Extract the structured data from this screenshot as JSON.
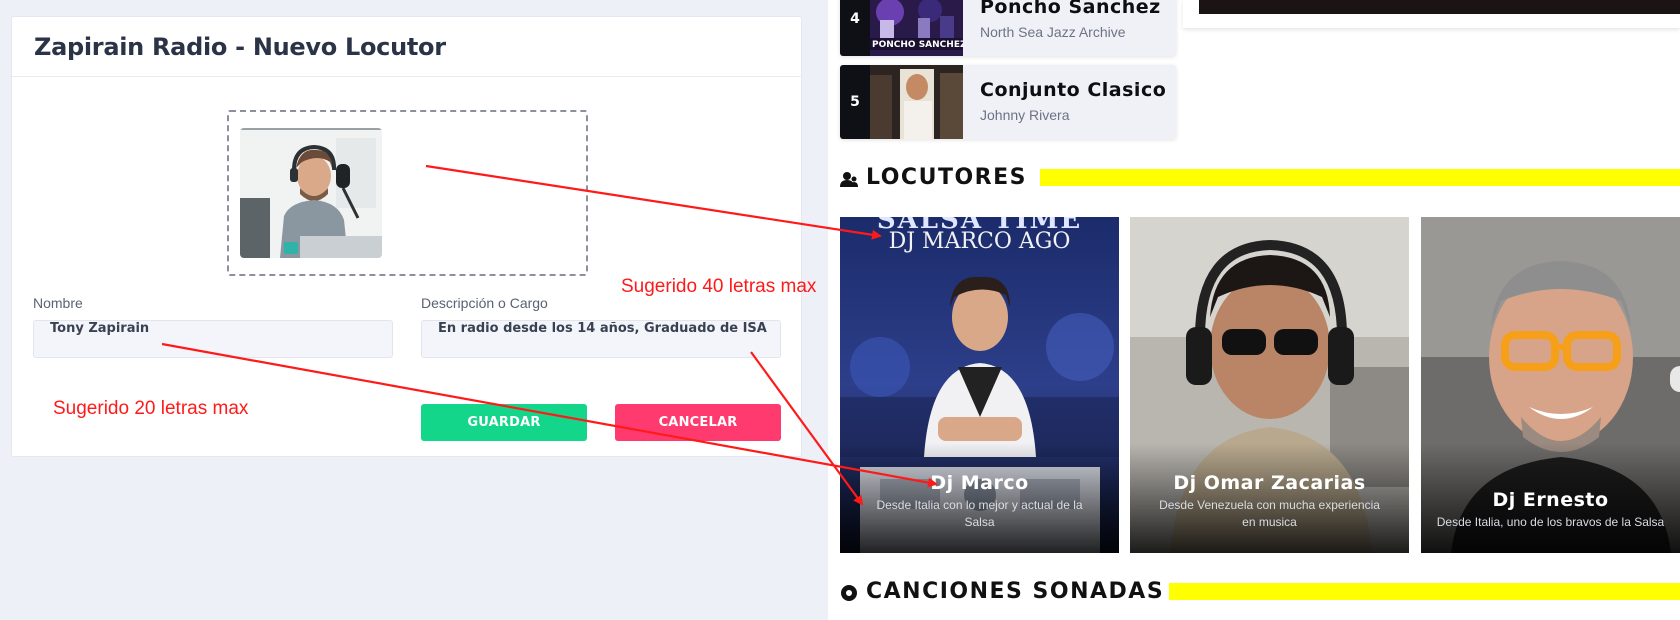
{
  "form": {
    "title": "Zapirain Radio - Nuevo Locutor",
    "name_label": "Nombre",
    "name_value": "Tony Zapirain",
    "desc_label": "Descripción o Cargo",
    "desc_value": "En radio desde los 14 años, Graduado de ISA",
    "save_label": "GUARDAR",
    "cancel_label": "CANCELAR"
  },
  "annotations": {
    "name_hint": "Sugerido 20 letras max",
    "desc_hint": "Sugerido 40 letras max"
  },
  "tracks": [
    {
      "number": "4",
      "title": "Poncho Sanchez",
      "artist": "North Sea Jazz Archive",
      "thumb_text": "PONCHO SANCHEZ"
    },
    {
      "number": "5",
      "title": "Conjunto Clasico",
      "artist": "Johnny Rivera"
    }
  ],
  "sections": {
    "locutores": "LOCUTORES",
    "canciones": "CANCIONES SONADAS"
  },
  "djs": [
    {
      "name": "Dj Marco",
      "description": "Desde Italia con lo mejor y actual de la Salsa",
      "poster_top": "SALSA TIME",
      "poster_name": "DJ MARCO AGO"
    },
    {
      "name": "Dj Omar Zacarias",
      "description": "Desde Venezuela con mucha experiencia en musica"
    },
    {
      "name": "Dj Ernesto",
      "description": "Desde Italia, uno de los bravos de la Salsa"
    }
  ],
  "colors": {
    "accent_yellow": "#ffff00",
    "save_button": "#14d68a",
    "cancel_button": "#ff3a6e",
    "annotation": "#ff1a1a"
  }
}
